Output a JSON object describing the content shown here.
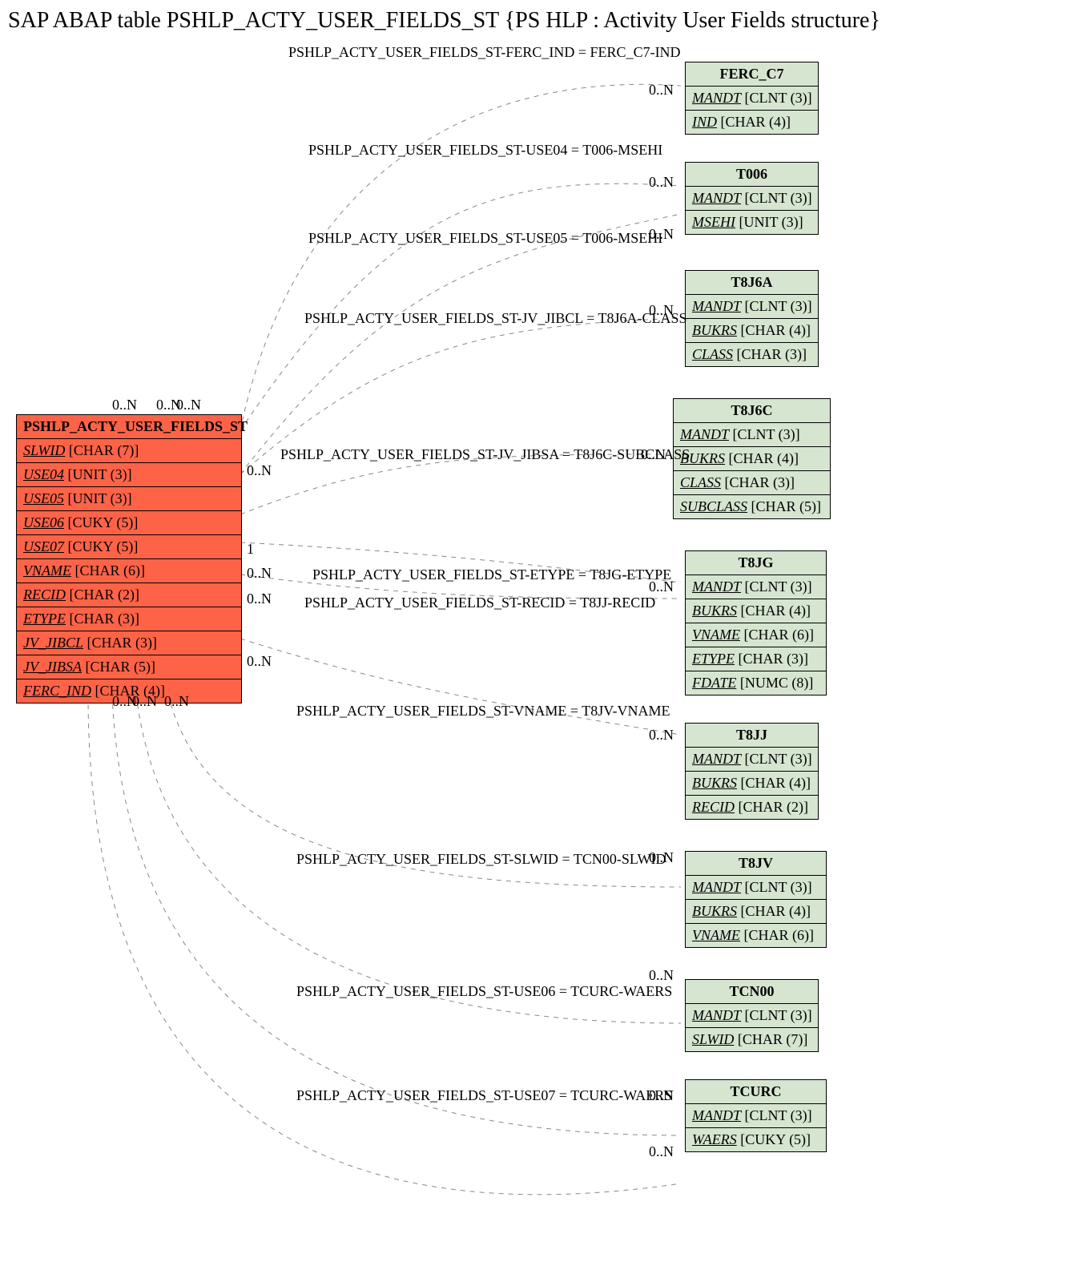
{
  "title": "SAP ABAP table PSHLP_ACTY_USER_FIELDS_ST {PS HLP : Activity User Fields structure}",
  "main_entity": {
    "name": "PSHLP_ACTY_USER_FIELDS_ST",
    "fields": [
      {
        "name": "SLWID",
        "type": "[CHAR (7)]"
      },
      {
        "name": "USE04",
        "type": "[UNIT (3)]"
      },
      {
        "name": "USE05",
        "type": "[UNIT (3)]"
      },
      {
        "name": "USE06",
        "type": "[CUKY (5)]"
      },
      {
        "name": "USE07",
        "type": "[CUKY (5)]"
      },
      {
        "name": "VNAME",
        "type": "[CHAR (6)]"
      },
      {
        "name": "RECID",
        "type": "[CHAR (2)]"
      },
      {
        "name": "ETYPE",
        "type": "[CHAR (3)]"
      },
      {
        "name": "JV_JIBCL",
        "type": "[CHAR (3)]"
      },
      {
        "name": "JV_JIBSA",
        "type": "[CHAR (5)]"
      },
      {
        "name": "FERC_IND",
        "type": "[CHAR (4)]"
      }
    ]
  },
  "related": [
    {
      "name": "FERC_C7",
      "fields": [
        {
          "name": "MANDT",
          "type": "[CLNT (3)]"
        },
        {
          "name": "IND",
          "type": "[CHAR (4)]"
        }
      ]
    },
    {
      "name": "T006",
      "fields": [
        {
          "name": "MANDT",
          "type": "[CLNT (3)]"
        },
        {
          "name": "MSEHI",
          "type": "[UNIT (3)]"
        }
      ]
    },
    {
      "name": "T8J6A",
      "fields": [
        {
          "name": "MANDT",
          "type": "[CLNT (3)]"
        },
        {
          "name": "BUKRS",
          "type": "[CHAR (4)]"
        },
        {
          "name": "CLASS",
          "type": "[CHAR (3)]"
        }
      ]
    },
    {
      "name": "T8J6C",
      "fields": [
        {
          "name": "MANDT",
          "type": "[CLNT (3)]"
        },
        {
          "name": "BUKRS",
          "type": "[CHAR (4)]"
        },
        {
          "name": "CLASS",
          "type": "[CHAR (3)]"
        },
        {
          "name": "SUBCLASS",
          "type": "[CHAR (5)]"
        }
      ]
    },
    {
      "name": "T8JG",
      "fields": [
        {
          "name": "MANDT",
          "type": "[CLNT (3)]"
        },
        {
          "name": "BUKRS",
          "type": "[CHAR (4)]"
        },
        {
          "name": "VNAME",
          "type": "[CHAR (6)]"
        },
        {
          "name": "ETYPE",
          "type": "[CHAR (3)]"
        },
        {
          "name": "FDATE",
          "type": "[NUMC (8)]"
        }
      ]
    },
    {
      "name": "T8JJ",
      "fields": [
        {
          "name": "MANDT",
          "type": "[CLNT (3)]"
        },
        {
          "name": "BUKRS",
          "type": "[CHAR (4)]"
        },
        {
          "name": "RECID",
          "type": "[CHAR (2)]"
        }
      ]
    },
    {
      "name": "T8JV",
      "fields": [
        {
          "name": "MANDT",
          "type": "[CLNT (3)]"
        },
        {
          "name": "BUKRS",
          "type": "[CHAR (4)]"
        },
        {
          "name": "VNAME",
          "type": "[CHAR (6)]"
        }
      ]
    },
    {
      "name": "TCN00",
      "fields": [
        {
          "name": "MANDT",
          "type": "[CLNT (3)]"
        },
        {
          "name": "SLWID",
          "type": "[CHAR (7)]"
        }
      ]
    },
    {
      "name": "TCURC",
      "fields": [
        {
          "name": "MANDT",
          "type": "[CLNT (3)]"
        },
        {
          "name": "WAERS",
          "type": "[CUKY (5)]"
        }
      ]
    }
  ],
  "relations": [
    {
      "label": "PSHLP_ACTY_USER_FIELDS_ST-FERC_IND = FERC_C7-IND"
    },
    {
      "label": "PSHLP_ACTY_USER_FIELDS_ST-USE04 = T006-MSEHI"
    },
    {
      "label": "PSHLP_ACTY_USER_FIELDS_ST-USE05 = T006-MSEHI"
    },
    {
      "label": "PSHLP_ACTY_USER_FIELDS_ST-JV_JIBCL = T8J6A-CLASS"
    },
    {
      "label": "PSHLP_ACTY_USER_FIELDS_ST-JV_JIBSA = T8J6C-SUBCLASS"
    },
    {
      "label": "PSHLP_ACTY_USER_FIELDS_ST-ETYPE = T8JG-ETYPE"
    },
    {
      "label": "PSHLP_ACTY_USER_FIELDS_ST-RECID = T8JJ-RECID"
    },
    {
      "label": "PSHLP_ACTY_USER_FIELDS_ST-VNAME = T8JV-VNAME"
    },
    {
      "label": "PSHLP_ACTY_USER_FIELDS_ST-SLWID = TCN00-SLWID"
    },
    {
      "label": "PSHLP_ACTY_USER_FIELDS_ST-USE06 = TCURC-WAERS"
    },
    {
      "label": "PSHLP_ACTY_USER_FIELDS_ST-USE07 = TCURC-WAERS"
    }
  ],
  "cards": {
    "zero_n": "0..N",
    "one": "1"
  }
}
